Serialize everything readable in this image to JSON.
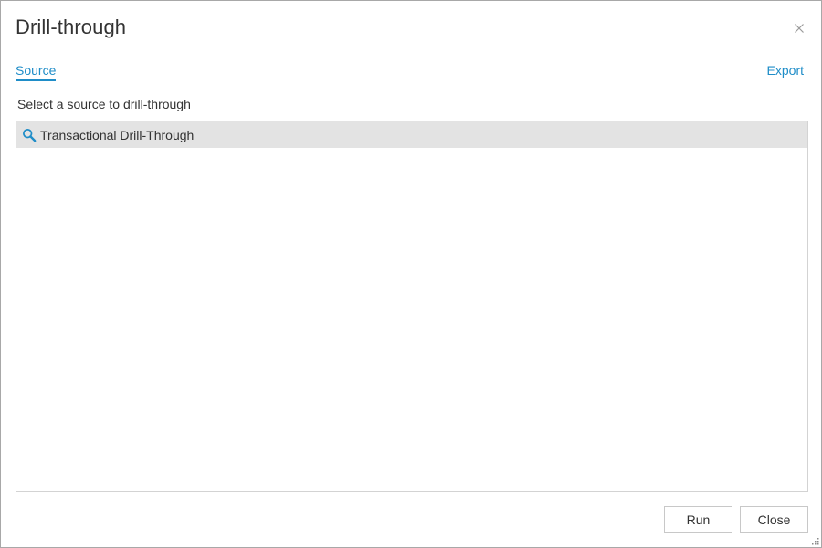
{
  "dialog": {
    "title": "Drill-through"
  },
  "tabs": {
    "source_label": "Source",
    "export_label": "Export"
  },
  "instruction": "Select a source to drill-through",
  "sources": {
    "items": [
      {
        "label": "Transactional Drill-Through",
        "icon": "search-icon"
      }
    ]
  },
  "footer": {
    "run_label": "Run",
    "close_label": "Close"
  },
  "colors": {
    "accent": "#1f8dc8",
    "selected_row": "#e3e3e3",
    "text": "#333333"
  }
}
